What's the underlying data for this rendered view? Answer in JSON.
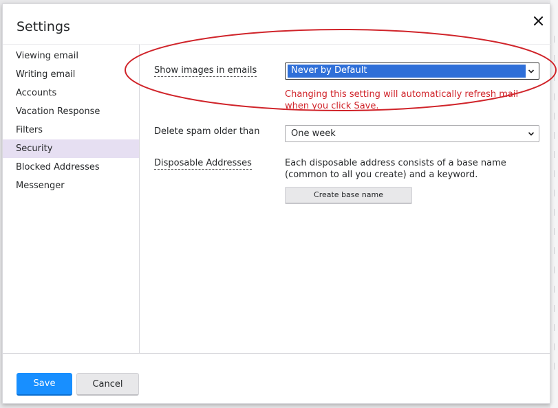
{
  "dialog": {
    "title": "Settings",
    "close_icon": "close-icon"
  },
  "sidebar": {
    "items": [
      {
        "label": "Viewing email",
        "active": false
      },
      {
        "label": "Writing email",
        "active": false
      },
      {
        "label": "Accounts",
        "active": false
      },
      {
        "label": "Vacation Response",
        "active": false
      },
      {
        "label": "Filters",
        "active": false
      },
      {
        "label": "Security",
        "active": true
      },
      {
        "label": "Blocked Addresses",
        "active": false
      },
      {
        "label": "Messenger",
        "active": false
      }
    ]
  },
  "security": {
    "show_images": {
      "label": "Show images in emails",
      "value": "Never by Default",
      "warning": "Changing this setting will automatically refresh mail when you click Save."
    },
    "delete_spam": {
      "label": "Delete spam older than",
      "value": "One week"
    },
    "disposable": {
      "label": "Disposable Addresses",
      "description": "Each disposable address consists of a base name (common to all you create) and a keyword.",
      "button_label": "Create base name"
    }
  },
  "footer": {
    "save_label": "Save",
    "cancel_label": "Cancel"
  },
  "colors": {
    "primary": "#188fff",
    "active_nav": "#e6dff2",
    "warning": "#d0242a",
    "annotation": "#d0242a",
    "selection": "#2f6fd8"
  }
}
